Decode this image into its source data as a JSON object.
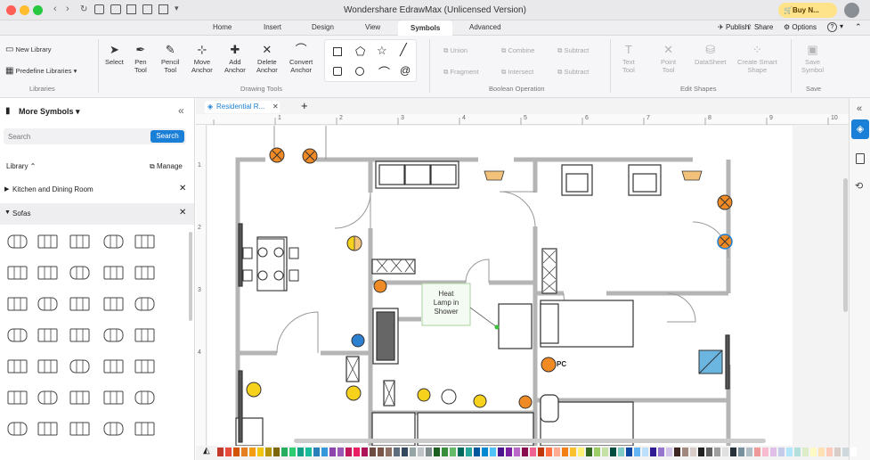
{
  "window": {
    "title": "Wondershare EdrawMax (Unlicensed Version)",
    "buy_label": "Buy N..."
  },
  "menu_tabs": [
    {
      "label": "Home"
    },
    {
      "label": "Insert"
    },
    {
      "label": "Design"
    },
    {
      "label": "View"
    },
    {
      "label": "Symbols"
    },
    {
      "label": "Advanced"
    }
  ],
  "top_actions": {
    "publish": "Publish",
    "share": "Share",
    "options": "Options",
    "help": "?"
  },
  "ribbon": {
    "libraries": {
      "new_library": "New Library",
      "predefine_libraries": "Predefine Libraries",
      "group": "Libraries"
    },
    "drawing_tools": {
      "select": "Select",
      "pen": "Pen",
      "pen2": "Tool",
      "pencil": "Pencil",
      "pencil2": "Tool",
      "move": "Move",
      "move2": "Anchor",
      "add": "Add",
      "add2": "Anchor",
      "delete": "Delete",
      "delete2": "Anchor",
      "convert": "Convert",
      "convert2": "Anchor",
      "group": "Drawing Tools"
    },
    "boolean": {
      "union": "Union",
      "combine": "Combine",
      "subtract": "Subtract",
      "fragment": "Fragment",
      "intersect": "Intersect",
      "subtract2": "Subtract",
      "group": "Boolean Operation"
    },
    "edit_shapes": {
      "text": "Text",
      "text2": "Tool",
      "point": "Point",
      "point2": "Tool",
      "datasheet": "DataSheet",
      "smart": "Create Smart",
      "smart2": "Shape",
      "group": "Edit Shapes"
    },
    "save": {
      "save": "Save",
      "save2": "Symbol",
      "group": "Save"
    }
  },
  "left_panel": {
    "title": "More Symbols",
    "search_placeholder": "Search",
    "search_button": "Search",
    "library_label": "Library",
    "manage_label": "Manage",
    "categories": [
      {
        "label": "Kitchen and Dining Room"
      },
      {
        "label": "Sofas"
      }
    ]
  },
  "document_tab": {
    "label": "Residential R..."
  },
  "ruler": {
    "marks": [
      "1",
      "2",
      "3",
      "4",
      "5",
      "6",
      "7",
      "8",
      "9",
      "10"
    ],
    "v_marks": [
      "1",
      "2",
      "3",
      "4"
    ]
  },
  "canvas": {
    "callout_l1": "Heat",
    "callout_l2": "Lamp in",
    "callout_l3": "Shower",
    "pc_label": "PC"
  },
  "colors": {
    "accent": "#1a7fd6",
    "wall": "#b5b5b5",
    "fixture_orange": "#f08a24",
    "fixture_yellow": "#f7d21c"
  }
}
